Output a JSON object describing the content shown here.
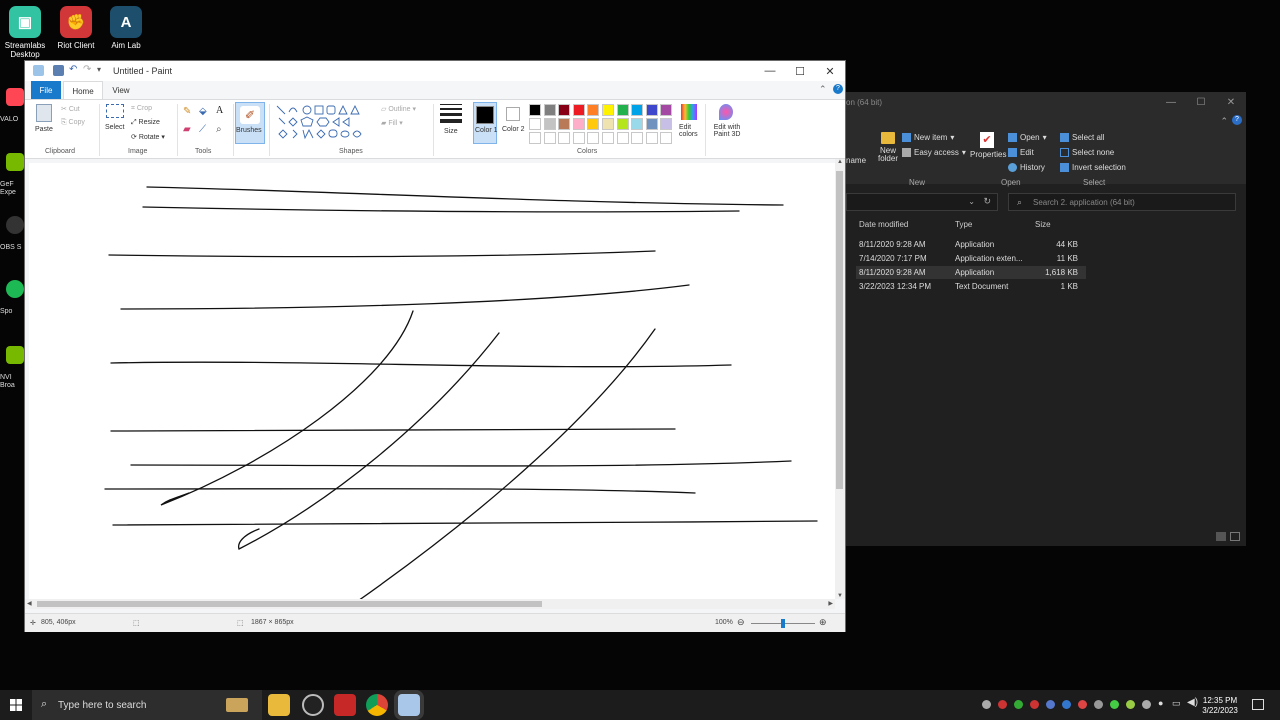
{
  "desktop": {
    "icons": [
      {
        "label": "Streamlabs Desktop",
        "color": "#31c3a2"
      },
      {
        "label": "Riot Client",
        "color": "#d13639"
      },
      {
        "label": "Aim Lab",
        "color": "#1d4e6b"
      }
    ],
    "side_icons": [
      {
        "label": "VALO",
        "color": "#ff4655"
      },
      {
        "label": "GeF\nExpe",
        "color": "#76b900"
      },
      {
        "label": "OBS S",
        "color": "#333333"
      },
      {
        "label": "Spo",
        "color": "#1db954"
      },
      {
        "label": "NVI\nBroa",
        "color": "#76b900"
      }
    ]
  },
  "explorer": {
    "title": "on (64 bit)",
    "ribbon": {
      "name_label": "name",
      "new_folder": "New folder",
      "new_item": "New item",
      "easy_access": "Easy access",
      "properties": "Properties",
      "open": "Open",
      "edit": "Edit",
      "history": "History",
      "select_all": "Select all",
      "select_none": "Select none",
      "invert_selection": "Invert selection",
      "groups": {
        "new": "New",
        "open": "Open",
        "select": "Select"
      }
    },
    "search_placeholder": "Search 2. application (64 bit)",
    "columns": {
      "date": "Date modified",
      "type": "Type",
      "size": "Size"
    },
    "rows": [
      {
        "date": "8/11/2020 9:28 AM",
        "type": "Application",
        "size": "44 KB"
      },
      {
        "date": "7/14/2020 7:17 PM",
        "type": "Application exten...",
        "size": "11 KB"
      },
      {
        "date": "8/11/2020 9:28 AM",
        "type": "Application",
        "size": "1,618 KB"
      },
      {
        "date": "3/22/2023 12:34 PM",
        "type": "Text Document",
        "size": "1 KB"
      }
    ]
  },
  "paint": {
    "title": "Untitled - Paint",
    "tabs": {
      "file": "File",
      "home": "Home",
      "view": "View"
    },
    "clipboard": {
      "paste": "Paste",
      "cut": "Cut",
      "copy": "Copy",
      "group": "Clipboard"
    },
    "image": {
      "select": "Select",
      "crop": "Crop",
      "resize": "Resize",
      "rotate": "Rotate",
      "group": "Image"
    },
    "tools": {
      "group": "Tools"
    },
    "brushes": {
      "label": "Brushes"
    },
    "shapes": {
      "outline": "Outline",
      "fill": "Fill",
      "group": "Shapes"
    },
    "size": {
      "label": "Size"
    },
    "colors": {
      "color1": "Color 1",
      "color2": "Color 2",
      "edit_colors": "Edit colors",
      "edit_paint3d": "Edit with Paint 3D",
      "group": "Colors",
      "palette": [
        "#000000",
        "#7f7f7f",
        "#880015",
        "#ed1c24",
        "#ff7f27",
        "#fff200",
        "#22b14c",
        "#00a2e8",
        "#3f48cc",
        "#a349a4",
        "#ffffff",
        "#c3c3c3",
        "#b97a57",
        "#ffaec9",
        "#ffc90e",
        "#efe4b0",
        "#b5e61d",
        "#99d9ea",
        "#7092be",
        "#c8bfe7"
      ]
    },
    "status": {
      "cursor": "805, 406px",
      "dimensions": "1867 × 865px",
      "zoom": "100%"
    }
  },
  "taskbar": {
    "search_placeholder": "Type here to search",
    "time": "12:35 PM",
    "date": "3/22/2023"
  }
}
